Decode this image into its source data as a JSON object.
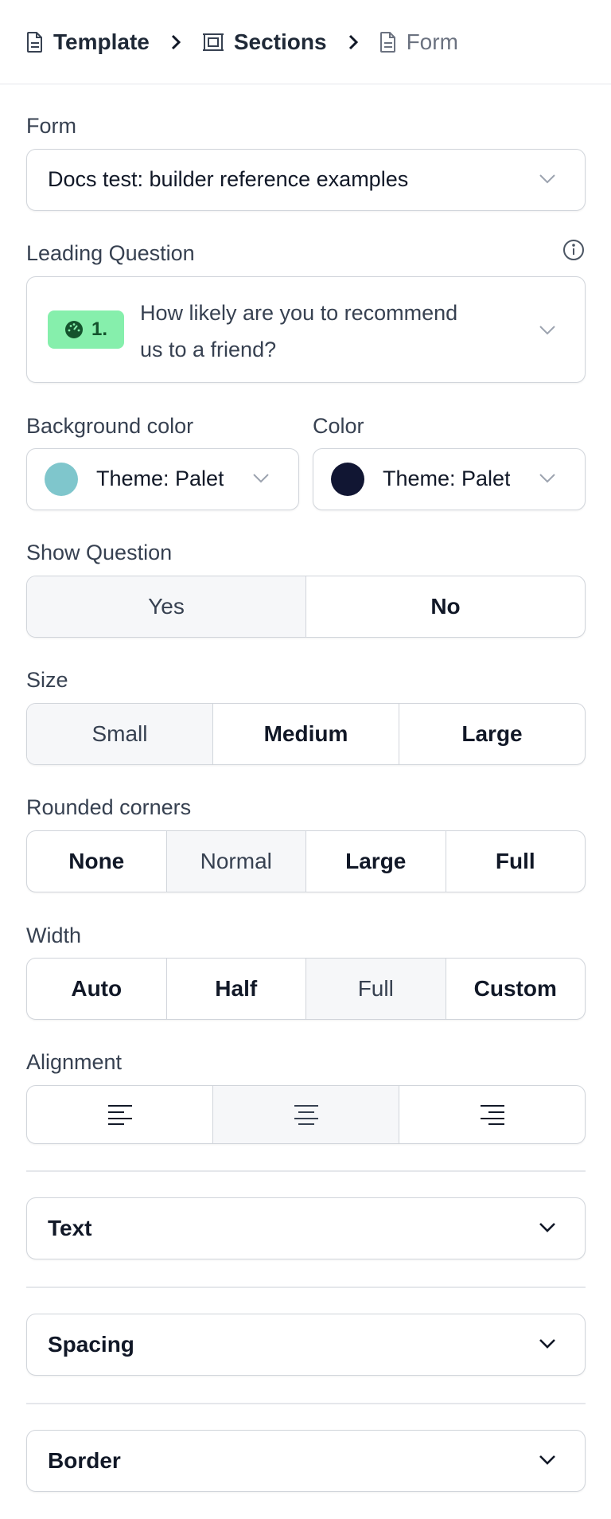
{
  "breadcrumb": {
    "items": [
      {
        "label": "Template",
        "icon": "document-icon"
      },
      {
        "label": "Sections",
        "icon": "sections-icon"
      },
      {
        "label": "Form",
        "icon": "document-icon"
      }
    ]
  },
  "form": {
    "label": "Form",
    "value": "Docs test: builder reference examples"
  },
  "leading_question": {
    "label": "Leading Question",
    "badge_number": "1.",
    "value_line1": "How likely are you to recommend",
    "value_line2": "us to a friend?"
  },
  "background_color": {
    "label": "Background color",
    "value": "Theme: Palette",
    "swatch": "#7fc6cc"
  },
  "color": {
    "label": "Color",
    "value": "Theme: Palette",
    "swatch": "#111633"
  },
  "show_question": {
    "label": "Show Question",
    "options": [
      "Yes",
      "No"
    ],
    "selected": "Yes"
  },
  "size": {
    "label": "Size",
    "options": [
      "Small",
      "Medium",
      "Large"
    ],
    "selected": "Small"
  },
  "rounded_corners": {
    "label": "Rounded corners",
    "options": [
      "None",
      "Normal",
      "Large",
      "Full"
    ],
    "selected": "Normal"
  },
  "width": {
    "label": "Width",
    "options": [
      "Auto",
      "Half",
      "Full",
      "Custom"
    ],
    "selected": "Full"
  },
  "alignment": {
    "label": "Alignment",
    "options": [
      "align-left-icon",
      "align-center-icon",
      "align-right-icon"
    ],
    "selected": "align-center-icon"
  },
  "accordions": {
    "text": "Text",
    "spacing": "Spacing",
    "border": "Border"
  },
  "colors": {
    "badge_bg": "#86efac",
    "selected_bg": "#f6f7f9",
    "border": "#d1d5db"
  }
}
